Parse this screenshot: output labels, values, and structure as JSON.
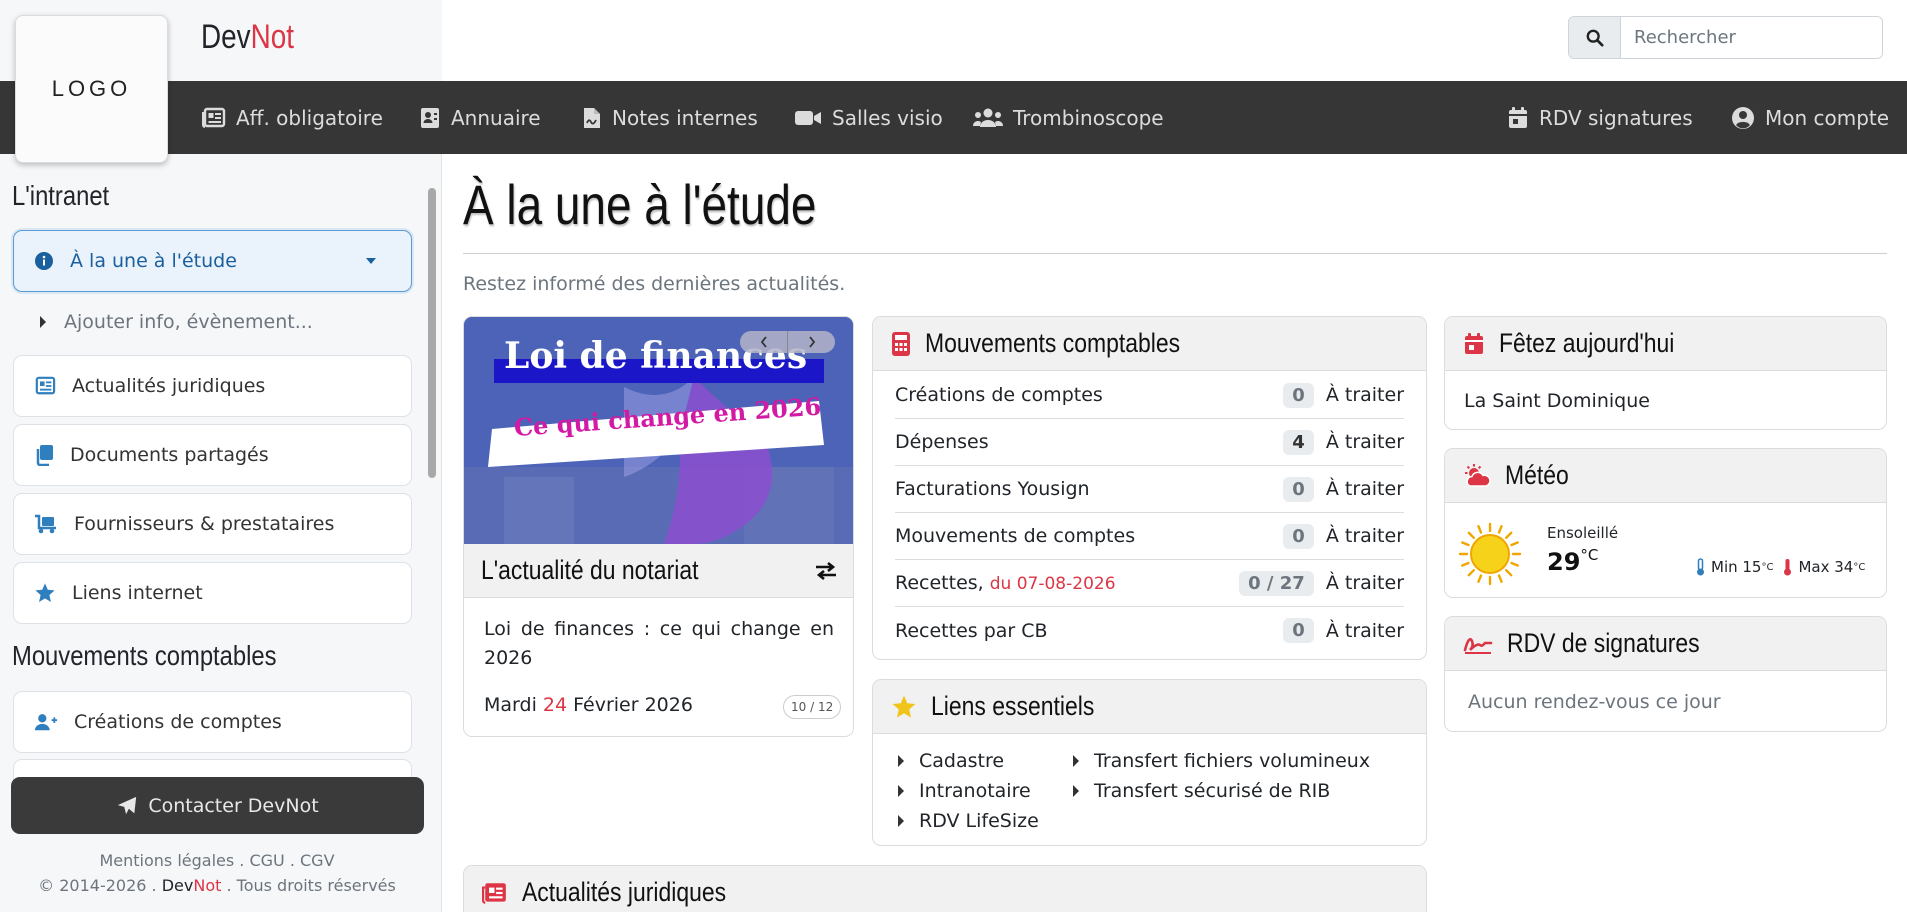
{
  "brand": {
    "logo_text": "LOGO",
    "name_part1": "Dev",
    "name_part2": "Not",
    "accent_color": "#dc3545"
  },
  "search": {
    "placeholder": "Rechercher"
  },
  "nav": {
    "items": [
      {
        "label": "Aff. obligatoire",
        "icon": "newspaper-icon"
      },
      {
        "label": "Annuaire",
        "icon": "address-card-icon"
      },
      {
        "label": "Notes internes",
        "icon": "file-signature-icon"
      },
      {
        "label": "Salles visio",
        "icon": "video-icon"
      },
      {
        "label": "Trombinoscope",
        "icon": "users-icon"
      }
    ],
    "right_items": [
      {
        "label": "RDV signatures",
        "icon": "calendar-check-icon"
      },
      {
        "label": "Mon compte",
        "icon": "user-circle-icon"
      }
    ]
  },
  "sidebar": {
    "section1_title": "L'intranet",
    "items": [
      {
        "label": "À la une à l'étude",
        "icon": "info-circle-icon",
        "active": true
      },
      {
        "label": "Ajouter info, évènement...",
        "icon": "caret-right-icon"
      },
      {
        "label": "Actualités juridiques",
        "icon": "newspaper-icon"
      },
      {
        "label": "Documents partagés",
        "icon": "copy-icon"
      },
      {
        "label": "Fournisseurs & prestataires",
        "icon": "dolly-icon"
      },
      {
        "label": "Liens internet",
        "icon": "star-icon"
      }
    ],
    "section2_title": "Mouvements comptables",
    "items2": [
      {
        "label": "Créations de comptes",
        "icon": "user-plus-icon"
      }
    ],
    "contact_label": "Contacter DevNot",
    "footer_links": "Mentions légales . CGU . CGV",
    "footer_copy_prefix": "© 2014-2026 . ",
    "footer_brand1": "Dev",
    "footer_brand2": "Not",
    "footer_copy_suffix": " . Tous droits réservés"
  },
  "main": {
    "title": "À la une à l'étude",
    "subtitle": "Restez informé des dernières actualités."
  },
  "news": {
    "image_title": "Loi de finances",
    "image_subtitle": "Ce qui change en 2026",
    "heading": "L'actualité du notariat",
    "text": "Loi de finances : ce qui change en 2026",
    "date_prefix": "Mardi ",
    "date_day": "24",
    "date_suffix": " Février 2026",
    "counter": "10 / 12"
  },
  "mouvements": {
    "title": "Mouvements comptables",
    "rows": [
      {
        "label": "Créations de comptes",
        "date": "",
        "count": "0",
        "status": "À traiter"
      },
      {
        "label": "Dépenses",
        "date": "",
        "count": "4",
        "status": "À traiter"
      },
      {
        "label": "Facturations Yousign",
        "date": "",
        "count": "0",
        "status": "À traiter"
      },
      {
        "label": "Mouvements de comptes",
        "date": "",
        "count": "0",
        "status": "À traiter"
      },
      {
        "label": "Recettes,",
        "date": "du 07-08-2026",
        "count": "0 / 27",
        "status": "À traiter"
      },
      {
        "label": "Recettes par CB",
        "date": "",
        "count": "0",
        "status": "À traiter"
      }
    ]
  },
  "liens": {
    "title": "Liens essentiels",
    "col1": [
      "Cadastre",
      "Intranotaire",
      "RDV LifeSize"
    ],
    "col2": [
      "Transfert fichiers volumineux",
      "Transfert sécurisé de RIB"
    ]
  },
  "actualites": {
    "title": "Actualités juridiques"
  },
  "fetez": {
    "title": "Fêtez aujourd'hui",
    "text": "La Saint Dominique"
  },
  "meteo": {
    "title": "Météo",
    "condition": "Ensoleillé",
    "temp": "29",
    "unit": "°C",
    "min_label": "Min 15",
    "max_label": "Max 34"
  },
  "rdv": {
    "title": "RDV de signatures",
    "text": "Aucun rendez-vous ce jour"
  }
}
